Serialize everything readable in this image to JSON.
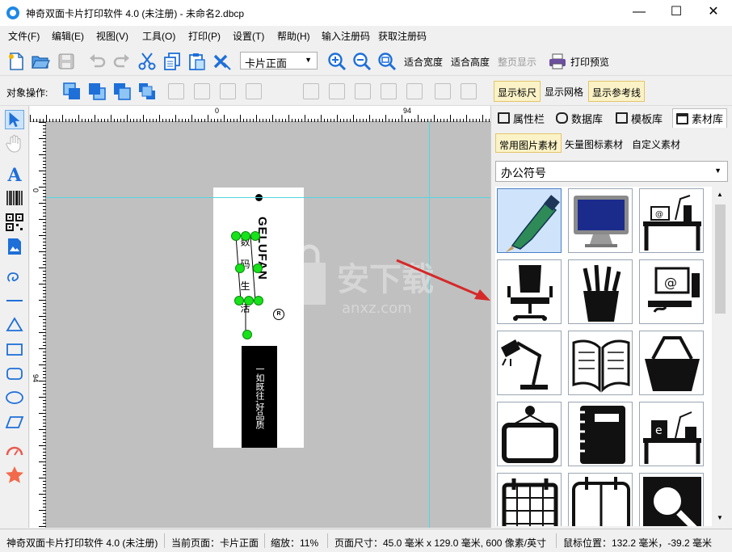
{
  "window": {
    "title": "神奇双面卡片打印软件 4.0 (未注册) - 未命名2.dbcp",
    "minimize": "—",
    "maximize": "☐",
    "close": "✕"
  },
  "menu": [
    "文件(F)",
    "编辑(E)",
    "视图(V)",
    "工具(O)",
    "打印(P)",
    "设置(T)",
    "帮助(H)",
    "输入注册码",
    "获取注册码"
  ],
  "toolbar": {
    "page_select": "卡片正面",
    "fit_width": "适合宽度",
    "fit_height": "适合高度",
    "full_page": "整页显示",
    "print_preview": "打印预览"
  },
  "object_toolbar": {
    "label": "对象操作:",
    "show_ruler": "显示标尺",
    "show_grid": "显示网格",
    "show_guides": "显示参考线"
  },
  "rulers": {
    "h_zero": "0",
    "h_end": "94",
    "v_zero": "0",
    "v_end": "94"
  },
  "canvas": {
    "card_brand": "GELUFAN",
    "card_slogan": "数 码 生 活",
    "card_box_text": "一如既往,好品质",
    "registered_mark": "R",
    "watermark_text": "安下载",
    "watermark_sub": "anxz.com"
  },
  "right_panel": {
    "tabs": [
      "属性栏",
      "数据库",
      "模板库",
      "素材库"
    ],
    "active_tab": "素材库",
    "subtabs": [
      "常用图片素材",
      "矢量图标素材",
      "自定义素材"
    ],
    "category": "办公符号",
    "tiles": [
      "pen",
      "monitor",
      "desk-computer",
      "office-chair",
      "pencil-cup",
      "desktop-mail",
      "desk-lamp",
      "open-book",
      "basket",
      "frame",
      "notebook",
      "desk-phone",
      "calendar",
      "planner",
      "magnifier"
    ]
  },
  "status": {
    "app": "神奇双面卡片打印软件 4.0 (未注册)",
    "current_page": "当前页面：卡片正面",
    "zoom": "缩放：11%",
    "page_size": "页面尺寸：45.0 毫米 x 129.0 毫米, 600 像素/英寸",
    "mouse_pos": "鼠标位置：132.2 毫米，-39.2 毫米"
  },
  "colors": {
    "guide": "#54d6df",
    "handle": "#18e21a",
    "arrow": "#d62828",
    "toggle_on": "#fbf3c7",
    "icon_blue": "#1e6fd8"
  }
}
